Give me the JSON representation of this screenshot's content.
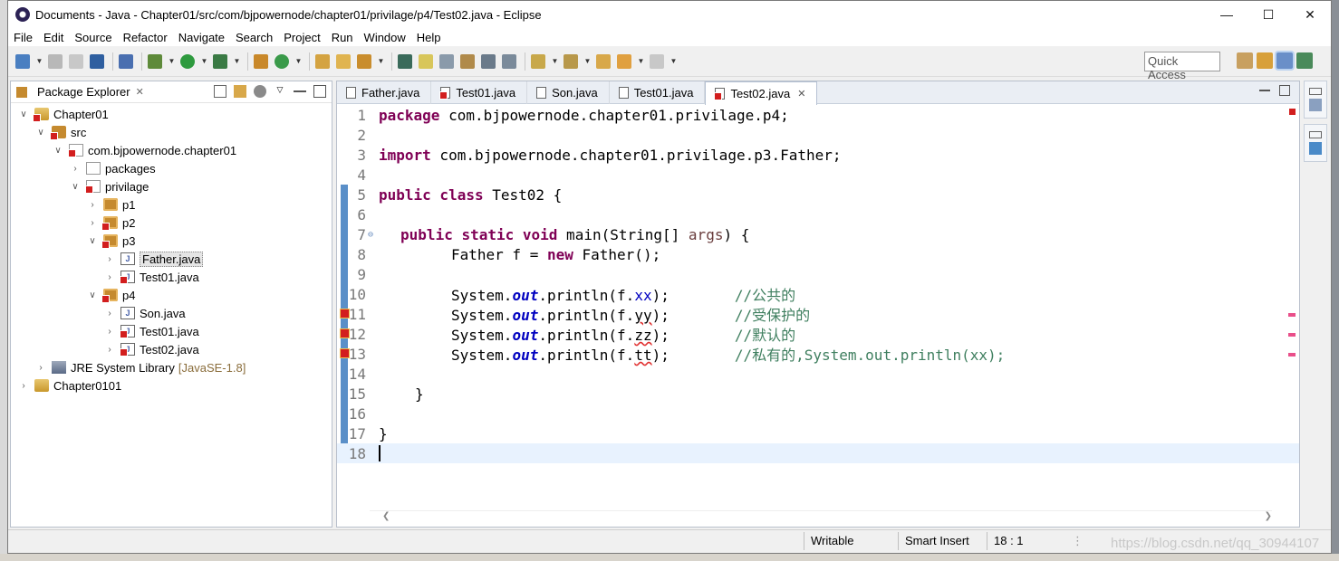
{
  "window": {
    "title": "Documents - Java - Chapter01/src/com/bjpowernode/chapter01/privilage/p4/Test02.java - Eclipse"
  },
  "menu": [
    "File",
    "Edit",
    "Source",
    "Refactor",
    "Navigate",
    "Search",
    "Project",
    "Run",
    "Window",
    "Help"
  ],
  "toolbar": {
    "quick_access": "Quick Access"
  },
  "package_explorer": {
    "title": "Package Explorer",
    "tree": [
      {
        "label": "Chapter01"
      },
      {
        "label": "src"
      },
      {
        "label": "com.bjpowernode.chapter01"
      },
      {
        "label": "packages"
      },
      {
        "label": "privilage"
      },
      {
        "label": "p1"
      },
      {
        "label": "p2"
      },
      {
        "label": "p3"
      },
      {
        "label": "Father.java"
      },
      {
        "label": "Test01.java"
      },
      {
        "label": "p4"
      },
      {
        "label": "Son.java"
      },
      {
        "label": "Test01.java"
      },
      {
        "label": "Test02.java"
      },
      {
        "label": "JRE System Library",
        "note": "[JavaSE-1.8]"
      },
      {
        "label": "Chapter0101"
      }
    ]
  },
  "editor": {
    "tabs": [
      "Father.java",
      "Test01.java",
      "Son.java",
      "Test01.java",
      "Test02.java"
    ],
    "active_tab": "Test02.java",
    "lines": [
      "1",
      "2",
      "3",
      "4",
      "5",
      "6",
      "7",
      "8",
      "9",
      "10",
      "11",
      "12",
      "13",
      "14",
      "15",
      "16",
      "17",
      "18"
    ],
    "code": {
      "l1_kw": "package",
      "l1_rest": " com.bjpowernode.chapter01.privilage.p4;",
      "l3_kw": "import",
      "l3_rest": " com.bjpowernode.chapter01.privilage.p3.Father;",
      "l5_kw": "public class",
      "l5_rest": " Test02 {",
      "l7_kw": "public static void",
      "l7_rest": " main(String[] ",
      "l7_var": "args",
      "l7_end": ") {",
      "l8_a": "Father f = ",
      "l8_kw": "new",
      "l8_b": " Father();",
      "sys": "System.",
      "out": "out",
      "println": ".println(f.",
      "l10_f": "xx",
      "l10_c": "//公共的",
      "l11_f": "yy",
      "l11_c": "//受保护的",
      "l12_f": "zz",
      "l12_c": "//默认的",
      "l13_f": "tt",
      "l13_c": "//私有的,System.out.println(xx);",
      "close_paren": ");",
      "l15": "}",
      "l17": "}"
    }
  },
  "status": {
    "writable": "Writable",
    "insert_mode": "Smart Insert",
    "position": "18 : 1"
  },
  "watermark": "https://blog.csdn.net/qq_30944107"
}
